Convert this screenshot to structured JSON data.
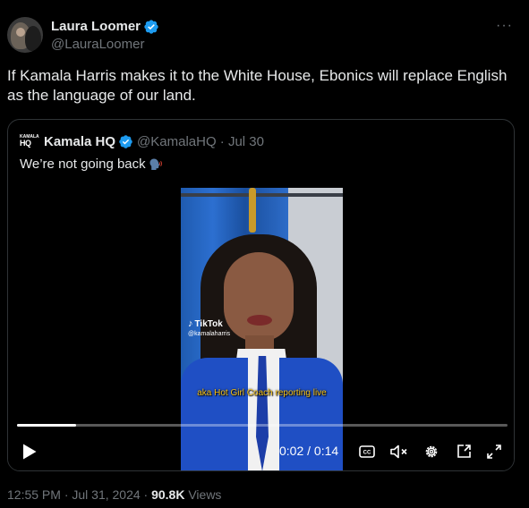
{
  "author": {
    "display_name": "Laura Loomer",
    "handle": "@LauraLoomer",
    "verified": true
  },
  "more_icon": "ellipsis-icon",
  "tweet_text": "If Kamala Harris makes it to the White House, Ebonics will replace English as the language of our land.",
  "quote": {
    "logo_text": "HQ",
    "logo_small": "KAMALA",
    "display_name": "Kamala HQ",
    "verified": true,
    "meta": "@KamalaHQ · Jul 30",
    "text": "We’re not going back",
    "emoji_icon": "speaking-head-icon"
  },
  "video": {
    "tiktok_label": "TikTok",
    "tiktok_handle": "@kamalaharris",
    "caption": "aka Hot Girl Coach reporting live",
    "progress": 0.12,
    "time": "0:02 / 0:14"
  },
  "footer": {
    "timestamp": "12:55 PM · Jul 31, 2024 · ",
    "views_count": "90.8K",
    "views_label": " Views"
  },
  "colors": {
    "background": "#000000",
    "text": "#e7e9ea",
    "secondary": "#71767b",
    "verified_blue": "#1d9bf0",
    "border": "#2f3336"
  }
}
